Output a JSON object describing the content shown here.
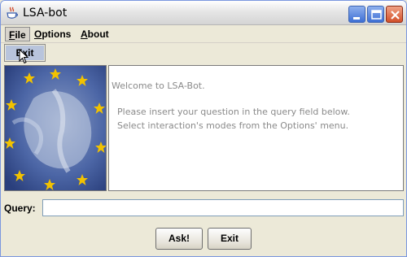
{
  "window": {
    "title": "LSA-bot",
    "app_icon": "java-cup-icon"
  },
  "title_controls": [
    "minimize-icon",
    "maximize-icon",
    "close-icon"
  ],
  "menubar": {
    "file": {
      "mnemonic": "F",
      "rest": "ile"
    },
    "options": {
      "mnemonic": "O",
      "rest": "ptions"
    },
    "about": {
      "mnemonic": "A",
      "rest": "bout"
    }
  },
  "file_menu": {
    "items": [
      {
        "label": "Exit"
      }
    ]
  },
  "image_panel": {
    "image": "europe-map-with-eu-stars"
  },
  "text_panel": {
    "line1": "Welcome to LSA-Bot.",
    "line2": "Please insert your question in the query field below.",
    "line3": "Select interaction's modes from the Options' menu."
  },
  "query": {
    "label": "Query:",
    "value": "",
    "placeholder": ""
  },
  "buttons": {
    "ask": "Ask!",
    "exit": "Exit"
  },
  "colors": {
    "menu_highlight": "#b8c4dc",
    "window_bg": "#ece9d8",
    "text_gray": "#8a8a8a"
  }
}
